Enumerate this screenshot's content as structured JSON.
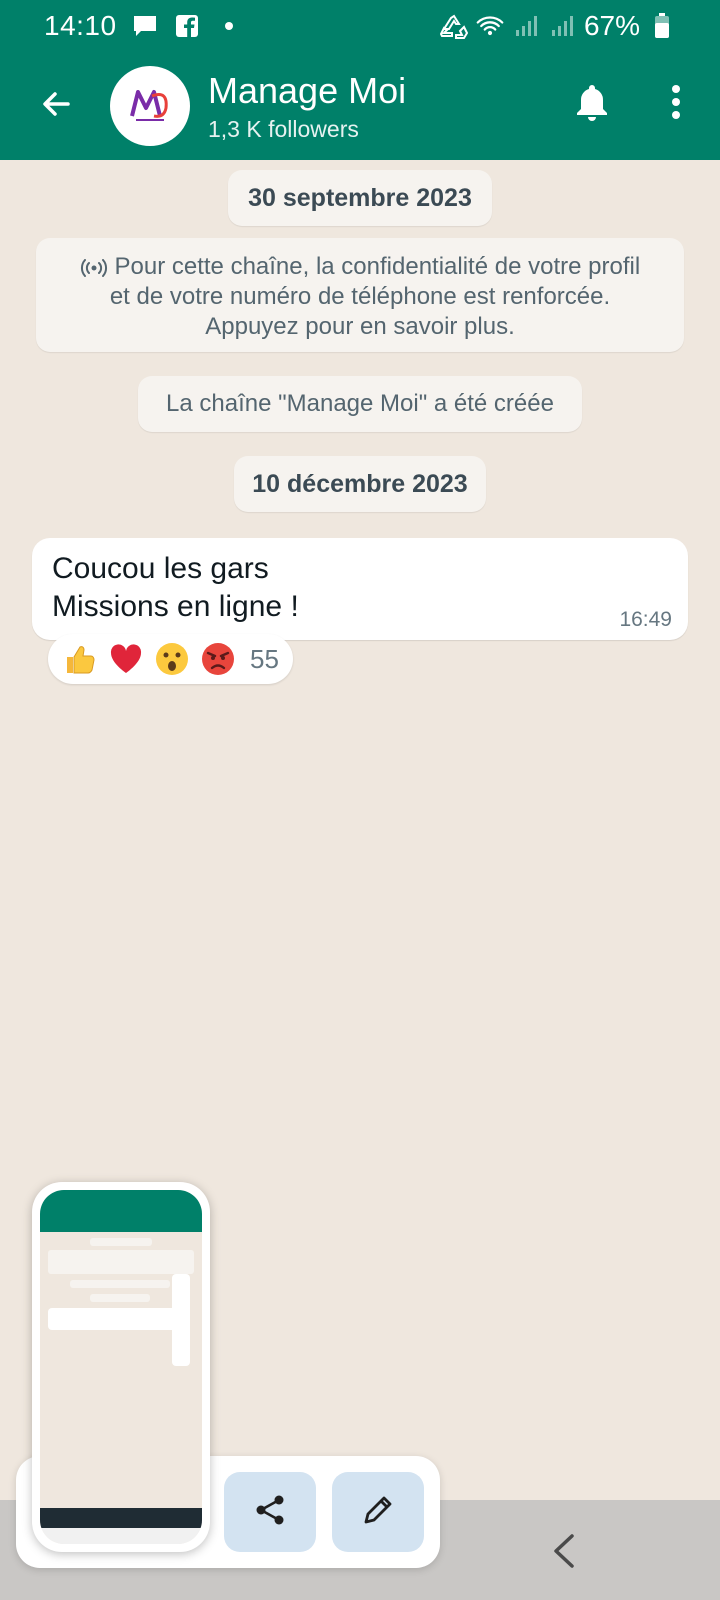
{
  "status_bar": {
    "time": "14:10",
    "battery": "67%",
    "icons": [
      "chat-icon",
      "facebook-icon",
      "dot-icon",
      "recycle-icon",
      "wifi-icon",
      "signal-icon",
      "signal-icon",
      "battery-icon"
    ]
  },
  "header": {
    "channel_name": "Manage Moi",
    "followers": "1,3 K followers",
    "back_icon": "arrow-left-icon",
    "bell_icon": "bell-icon",
    "more_icon": "more-vertical-icon",
    "color": "#008069"
  },
  "chat": {
    "date1": "30 septembre 2023",
    "privacy_line1": "Pour cette chaîne, la confidentialité de votre profil",
    "privacy_line2": "et de votre numéro de téléphone est renforcée.",
    "privacy_line3": "Appuyez pour en savoir plus.",
    "created": "La chaîne \"Manage Moi\" a été créée",
    "date2": "10 décembre 2023",
    "message_line1": "Coucou les gars",
    "message_line2": "Missions en ligne !",
    "message_time": "16:49",
    "reactions": [
      "thumbs-up",
      "heart",
      "surprised",
      "angry"
    ],
    "reaction_count": "55"
  },
  "overlay": {
    "share_icon": "share-icon",
    "edit_icon": "pencil-icon"
  }
}
